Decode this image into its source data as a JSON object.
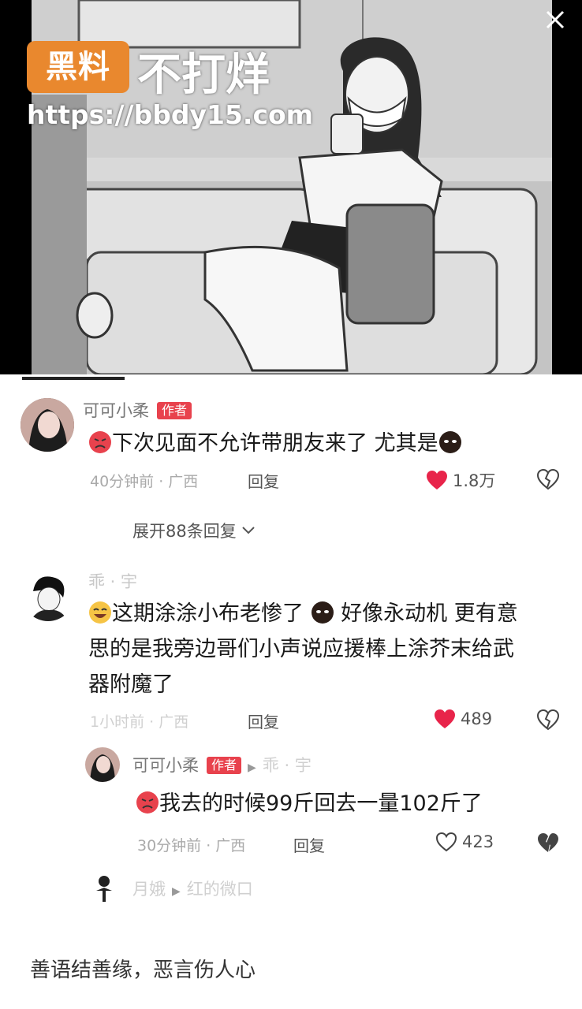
{
  "watermark": {
    "badge": "黑料",
    "text": "不打烊",
    "url": "https://bbdy15.com"
  },
  "top_right_icon": "close-icon",
  "comments": [
    {
      "author": "可可小柔",
      "badge": "作者",
      "text_before": "下次见面不允许带朋友来了 尤其是",
      "meta": "40分钟前 · 广西",
      "reply_label": "回复",
      "likes": "1.8万",
      "liked": true
    },
    {
      "author": "乖 · 宇",
      "text": "这期涂涂小布老惨了",
      "text2": "好像永动机 更有意",
      "text_line2": "思的是我旁边哥们小声说应援棒上涂芥末给武",
      "text_line3": "器附魔了",
      "meta": "1小时前 · 广西",
      "reply_label": "回复",
      "likes": "489",
      "liked": true
    },
    {
      "author": "可可小柔",
      "badge": "作者",
      "reply_to": "乖 · 宇",
      "text": "我去的时候99斤回去一量102斤了",
      "meta": "30分钟前 · 广西",
      "reply_label": "回复",
      "likes": "423",
      "liked": false
    },
    {
      "author": "月娥",
      "reply_to": "红的微口"
    }
  ],
  "expand_label": "展开88条回复",
  "bottom_input": {
    "placeholder": "善语结善缘，恶言伤人心"
  },
  "colors": {
    "accent_red": "#e8424d",
    "like_red": "#e8244a",
    "watermark_orange": "#e9882e"
  }
}
